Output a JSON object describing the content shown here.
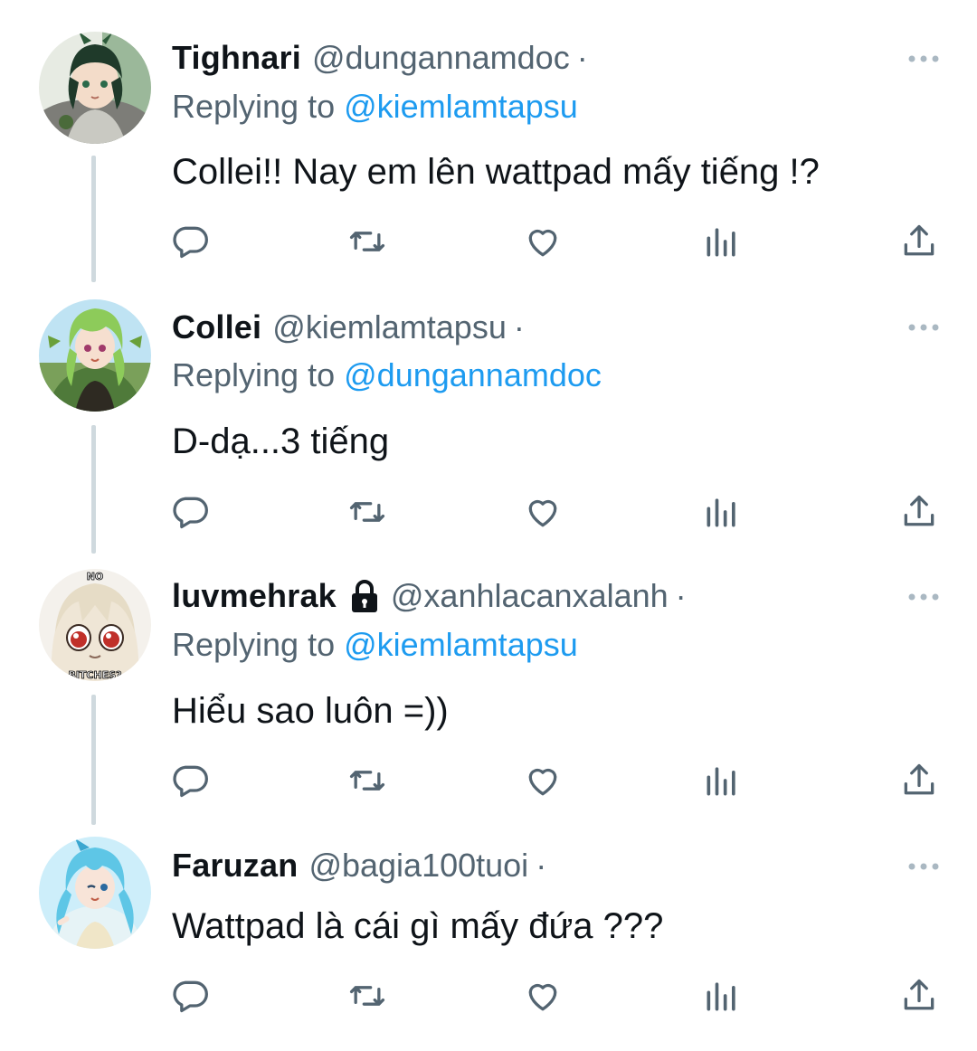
{
  "tweets": [
    {
      "display_name": "Tighnari",
      "handle": "@dungannamdoc",
      "separator": "·",
      "locked": false,
      "replying_prefix": "Replying to",
      "replying_to": "@kiemlamtapsu",
      "text": "Collei!! Nay em lên wattpad mấy tiếng !?"
    },
    {
      "display_name": "Collei",
      "handle": "@kiemlamtapsu",
      "separator": "·",
      "locked": false,
      "replying_prefix": "Replying to",
      "replying_to": "@dungannamdoc",
      "text": "D-dạ...3 tiếng"
    },
    {
      "display_name": "luvmehrak",
      "handle": "@xanhlacanxalanh",
      "separator": "·",
      "locked": true,
      "replying_prefix": "Replying to",
      "replying_to": "@kiemlamtapsu",
      "text": "Hiểu sao luôn =))"
    },
    {
      "display_name": "Faruzan",
      "handle": "@bagia100tuoi",
      "separator": "·",
      "locked": false,
      "text": "Wattpad là cái gì mấy đứa ???"
    }
  ],
  "avatar_texts": {
    "luvmehrak_top": "NO",
    "luvmehrak_bottom": "BITCHES?"
  },
  "icons": {
    "reply": "reply-icon",
    "retweet": "retweet-icon",
    "like": "heart-icon",
    "views": "views-icon",
    "share": "share-icon",
    "more": "more-icon",
    "protected": "lock-icon"
  },
  "colors": {
    "text": "#0f1419",
    "secondary": "#536471",
    "link": "#1d9bf0",
    "thread_line": "#cfd9de",
    "icon": "#536471"
  }
}
